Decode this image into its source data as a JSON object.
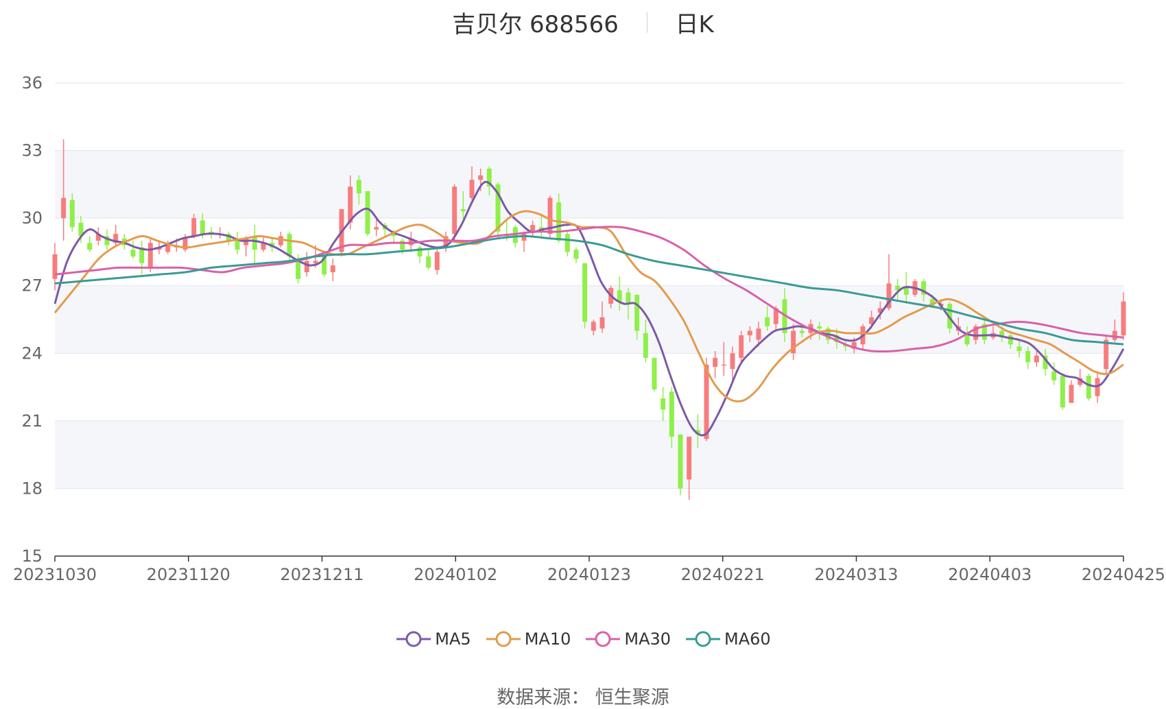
{
  "title": {
    "name": "吉贝尔 688566",
    "period": "日K"
  },
  "source": "数据来源：  恒生聚源",
  "colors": {
    "up": "#f87c7c",
    "down": "#8ef048",
    "MA5": "#7b5aa6",
    "MA10": "#e49a4c",
    "MA30": "#d861a9",
    "MA60": "#3a9a96",
    "grid": "#dfe3ef",
    "band": "#f5f6fa"
  },
  "chart_data": {
    "type": "candlestick",
    "ylim": [
      15,
      36
    ],
    "yticks": [
      15,
      18,
      21,
      24,
      27,
      30,
      33,
      36
    ],
    "xticks": [
      "20231030",
      "20231120",
      "20231211",
      "20240102",
      "20240123",
      "20240221",
      "20240313",
      "20240403",
      "20240425"
    ],
    "grid": true,
    "legend_position": "bottom-center",
    "candles": [
      [
        27.3,
        28.4,
        26.8,
        28.9
      ],
      [
        30.0,
        30.9,
        29.0,
        33.5
      ],
      [
        30.8,
        29.6,
        29.4,
        31.1
      ],
      [
        29.8,
        29.2,
        28.9,
        30.1
      ],
      [
        28.9,
        28.6,
        28.5,
        29.2
      ],
      [
        29.0,
        29.3,
        28.8,
        29.6
      ],
      [
        29.2,
        28.8,
        28.6,
        29.5
      ],
      [
        28.9,
        29.3,
        28.7,
        29.7
      ],
      [
        29.1,
        28.8,
        28.6,
        29.3
      ],
      [
        28.6,
        28.3,
        28.2,
        29.0
      ],
      [
        28.7,
        28.0,
        27.5,
        29.0
      ],
      [
        27.8,
        28.9,
        27.6,
        29.1
      ],
      [
        28.6,
        28.7,
        28.4,
        29.0
      ],
      [
        28.5,
        28.8,
        28.4,
        29.0
      ],
      [
        28.7,
        28.8,
        28.5,
        29.1
      ],
      [
        28.6,
        29.1,
        28.5,
        29.3
      ],
      [
        29.2,
        30.0,
        29.1,
        30.2
      ],
      [
        29.9,
        29.3,
        29.1,
        30.2
      ],
      [
        29.4,
        29.3,
        29.1,
        29.6
      ],
      [
        29.3,
        29.3,
        29.1,
        29.6
      ],
      [
        29.3,
        29.0,
        28.8,
        29.4
      ],
      [
        29.1,
        28.6,
        28.4,
        29.4
      ],
      [
        28.8,
        29.1,
        28.3,
        29.2
      ],
      [
        29.2,
        28.6,
        28.0,
        29.7
      ],
      [
        28.6,
        28.9,
        28.5,
        29.2
      ],
      [
        28.9,
        28.7,
        28.5,
        29.1
      ],
      [
        28.8,
        29.2,
        28.7,
        29.4
      ],
      [
        29.3,
        28.3,
        28.1,
        29.4
      ],
      [
        28.2,
        27.3,
        27.1,
        28.4
      ],
      [
        27.6,
        28.1,
        27.4,
        28.5
      ],
      [
        28.0,
        28.1,
        27.8,
        28.8
      ],
      [
        28.3,
        27.5,
        27.4,
        28.4
      ],
      [
        27.6,
        27.9,
        27.2,
        28.2
      ],
      [
        28.5,
        30.4,
        28.3,
        30.4
      ],
      [
        29.8,
        31.4,
        29.5,
        31.9
      ],
      [
        31.7,
        31.1,
        30.6,
        31.9
      ],
      [
        31.2,
        29.3,
        29.2,
        31.2
      ],
      [
        29.5,
        29.6,
        29.2,
        30.0
      ],
      [
        29.7,
        29.5,
        29.2,
        29.8
      ],
      [
        29.4,
        29.2,
        28.9,
        29.5
      ],
      [
        29.0,
        28.6,
        28.4,
        29.1
      ],
      [
        28.8,
        29.1,
        28.5,
        29.4
      ],
      [
        28.7,
        28.3,
        28.0,
        28.8
      ],
      [
        28.3,
        27.8,
        27.7,
        28.6
      ],
      [
        27.7,
        28.5,
        27.5,
        28.6
      ],
      [
        28.7,
        29.2,
        28.5,
        29.4
      ],
      [
        29.3,
        31.4,
        29.0,
        31.5
      ],
      [
        30.4,
        30.3,
        29.9,
        31.2
      ],
      [
        30.9,
        31.7,
        30.8,
        32.3
      ],
      [
        31.7,
        31.9,
        31.2,
        32.2
      ],
      [
        32.2,
        31.4,
        31.0,
        32.3
      ],
      [
        31.5,
        29.4,
        29.1,
        31.6
      ],
      [
        29.3,
        29.2,
        29.0,
        29.9
      ],
      [
        29.6,
        28.9,
        28.7,
        29.7
      ],
      [
        29.0,
        29.3,
        28.5,
        29.4
      ],
      [
        29.4,
        29.7,
        29.2,
        29.9
      ],
      [
        29.6,
        29.4,
        29.2,
        30.2
      ],
      [
        29.3,
        30.9,
        29.1,
        31.0
      ],
      [
        30.7,
        29.0,
        28.9,
        31.1
      ],
      [
        29.3,
        28.5,
        28.3,
        29.4
      ],
      [
        28.6,
        28.2,
        28.0,
        28.7
      ],
      [
        28.0,
        25.4,
        25.1,
        28.0
      ],
      [
        25.0,
        25.4,
        24.8,
        25.5
      ],
      [
        25.1,
        25.6,
        24.9,
        26.3
      ],
      [
        26.2,
        26.9,
        26.0,
        27.0
      ],
      [
        26.8,
        26.3,
        25.9,
        27.4
      ],
      [
        26.7,
        26.2,
        25.5,
        26.9
      ],
      [
        26.6,
        25.0,
        24.6,
        26.6
      ],
      [
        24.9,
        23.8,
        23.6,
        25.5
      ],
      [
        23.8,
        22.4,
        22.3,
        23.8
      ],
      [
        22.0,
        21.5,
        21.0,
        22.5
      ],
      [
        22.3,
        20.3,
        19.8,
        22.5
      ],
      [
        20.4,
        18.0,
        17.7,
        20.4
      ],
      [
        18.4,
        20.3,
        17.5,
        20.3
      ],
      [
        20.6,
        20.4,
        19.8,
        21.3
      ],
      [
        20.2,
        23.5,
        20.1,
        23.8
      ],
      [
        23.4,
        23.8,
        22.9,
        24.1
      ],
      [
        23.5,
        23.5,
        23.0,
        24.5
      ],
      [
        23.3,
        24.0,
        22.8,
        24.3
      ],
      [
        23.8,
        24.8,
        23.6,
        25.0
      ],
      [
        24.8,
        25.0,
        24.5,
        25.2
      ],
      [
        24.6,
        25.1,
        24.3,
        25.4
      ],
      [
        25.6,
        25.2,
        25.0,
        26.1
      ],
      [
        25.3,
        26.0,
        25.0,
        26.1
      ],
      [
        26.4,
        24.9,
        24.5,
        26.9
      ],
      [
        24.0,
        25.0,
        23.7,
        25.3
      ],
      [
        25.0,
        24.9,
        24.7,
        25.3
      ],
      [
        24.9,
        25.3,
        24.6,
        25.5
      ],
      [
        25.2,
        25.1,
        24.6,
        25.4
      ],
      [
        25.1,
        24.6,
        24.4,
        25.2
      ],
      [
        24.8,
        24.5,
        24.2,
        25.1
      ],
      [
        24.4,
        24.3,
        24.1,
        24.6
      ],
      [
        24.2,
        24.5,
        24.0,
        24.7
      ],
      [
        24.4,
        25.2,
        24.2,
        25.3
      ],
      [
        25.3,
        25.6,
        25.1,
        25.9
      ],
      [
        25.8,
        26.0,
        25.5,
        26.3
      ],
      [
        26.0,
        27.1,
        25.9,
        28.4
      ],
      [
        27.0,
        26.8,
        26.4,
        27.3
      ],
      [
        26.9,
        26.6,
        26.2,
        27.6
      ],
      [
        26.6,
        27.2,
        26.5,
        27.3
      ],
      [
        27.2,
        26.6,
        26.3,
        27.3
      ],
      [
        26.4,
        26.1,
        26.0,
        26.6
      ],
      [
        26.1,
        26.2,
        25.9,
        26.4
      ],
      [
        26.2,
        25.1,
        24.9,
        26.3
      ],
      [
        25.0,
        25.2,
        24.8,
        25.6
      ],
      [
        24.9,
        24.4,
        24.3,
        25.2
      ],
      [
        24.6,
        25.2,
        24.4,
        25.3
      ],
      [
        25.3,
        24.6,
        24.4,
        25.5
      ],
      [
        24.7,
        24.9,
        24.6,
        25.2
      ],
      [
        25.0,
        24.7,
        24.5,
        25.2
      ],
      [
        24.8,
        24.4,
        24.2,
        25.0
      ],
      [
        24.3,
        24.1,
        23.8,
        24.6
      ],
      [
        24.1,
        23.6,
        23.3,
        24.3
      ],
      [
        23.6,
        23.9,
        23.4,
        24.1
      ],
      [
        23.9,
        23.3,
        23.0,
        24.2
      ],
      [
        23.2,
        22.8,
        22.6,
        23.6
      ],
      [
        23.0,
        21.6,
        21.5,
        23.0
      ],
      [
        21.8,
        22.6,
        21.8,
        22.8
      ],
      [
        22.6,
        22.9,
        22.5,
        23.3
      ],
      [
        23.0,
        22.0,
        21.9,
        23.1
      ],
      [
        22.1,
        22.9,
        21.8,
        23.1
      ],
      [
        23.3,
        24.6,
        23.1,
        24.8
      ],
      [
        24.6,
        25.0,
        24.5,
        25.5
      ],
      [
        24.8,
        26.3,
        24.6,
        26.7
      ]
    ],
    "series": [
      {
        "name": "MA5",
        "values": [
          26.2,
          28.0,
          29.0,
          29.5,
          29.2,
          29.0,
          28.9,
          28.7,
          28.6,
          28.7,
          28.9,
          29.1,
          29.2,
          29.3,
          29.3,
          29.2,
          29.0,
          29.0,
          28.9,
          28.7,
          28.4,
          28.1,
          27.9,
          28.1,
          28.9,
          29.6,
          30.2,
          30.4,
          29.8,
          29.4,
          29.2,
          29.0,
          28.8,
          28.7,
          28.9,
          29.7,
          30.8,
          31.6,
          31.2,
          30.3,
          29.8,
          29.4,
          29.5,
          29.6,
          29.7,
          29.6,
          28.5,
          27.2,
          26.5,
          26.2,
          26.2,
          25.6,
          24.5,
          23.0,
          21.6,
          20.6,
          20.4,
          21.2,
          22.3,
          23.5,
          24.1,
          24.6,
          25.0,
          25.1,
          25.2,
          25.1,
          24.9,
          24.8,
          24.6,
          24.6,
          25.0,
          25.7,
          26.4,
          26.9,
          26.9,
          26.7,
          26.3,
          25.6,
          25.0,
          24.8,
          24.8,
          24.8,
          24.7,
          24.6,
          24.4,
          23.9,
          23.3,
          23.0,
          22.9,
          22.6,
          22.6,
          23.3,
          24.2
        ]
      },
      {
        "name": "MA10",
        "values": [
          25.8,
          26.6,
          27.4,
          28.2,
          28.7,
          29.0,
          29.2,
          29.0,
          28.8,
          28.7,
          28.8,
          28.9,
          29.0,
          29.1,
          29.2,
          29.1,
          29.0,
          28.9,
          28.6,
          28.4,
          28.4,
          28.7,
          29.0,
          29.3,
          29.6,
          29.7,
          29.4,
          29.0,
          28.9,
          28.9,
          29.4,
          30.0,
          30.3,
          30.2,
          29.9,
          29.8,
          29.6,
          29.6,
          29.4,
          28.4,
          27.6,
          27.2,
          26.4,
          25.4,
          24.0,
          22.7,
          22.0,
          21.9,
          22.4,
          23.3,
          24.0,
          24.5,
          24.9,
          25.0,
          24.9,
          24.9,
          24.9,
          25.2,
          25.6,
          25.9,
          26.2,
          26.4,
          26.2,
          25.8,
          25.4,
          25.0,
          24.8,
          24.6,
          24.4,
          24.0,
          23.6,
          23.2,
          23.1,
          23.5
        ]
      },
      {
        "name": "MA30",
        "values": [
          27.5,
          27.6,
          27.7,
          27.8,
          27.8,
          27.8,
          27.8,
          27.7,
          27.6,
          27.8,
          27.9,
          28.0,
          28.2,
          28.5,
          28.8,
          28.8,
          28.9,
          28.9,
          29.0,
          29.0,
          29.0,
          29.2,
          29.3,
          29.4,
          29.4,
          29.5,
          29.6,
          29.6,
          29.4,
          29.1,
          28.6,
          27.9,
          27.3,
          26.8,
          26.2,
          25.6,
          25.1,
          24.7,
          24.3,
          24.1,
          24.1,
          24.2,
          24.3,
          24.6,
          25.1,
          25.3,
          25.4,
          25.3,
          25.1,
          24.9,
          24.8,
          24.7
        ]
      },
      {
        "name": "MA60",
        "values": [
          27.1,
          27.2,
          27.3,
          27.4,
          27.5,
          27.6,
          27.8,
          27.9,
          28.0,
          28.1,
          28.3,
          28.4,
          28.4,
          28.5,
          28.6,
          28.7,
          28.9,
          29.1,
          29.2,
          29.1,
          29.0,
          28.8,
          28.4,
          28.1,
          27.9,
          27.7,
          27.5,
          27.3,
          27.1,
          26.9,
          26.8,
          26.6,
          26.4,
          26.2,
          26.0,
          25.7,
          25.4,
          25.1,
          24.9,
          24.6,
          24.5,
          24.4
        ]
      }
    ]
  }
}
